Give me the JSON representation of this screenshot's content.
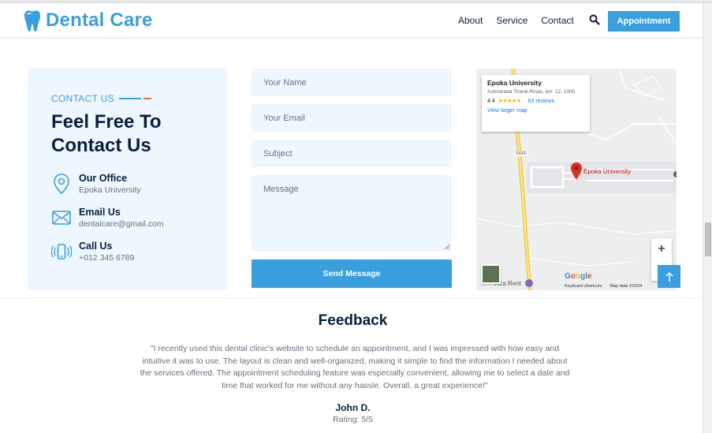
{
  "header": {
    "logo_text": "Dental Care",
    "nav": [
      "About",
      "Service",
      "Contact"
    ],
    "appointment_label": "Appointment"
  },
  "contact": {
    "eyebrow": "CONTACT US",
    "title": "Feel Free To Contact Us",
    "office_label": "Our Office",
    "office_value": "Epoka University",
    "email_label": "Email Us",
    "email_value": "dentalcare@gmail.com",
    "call_label": "Call Us",
    "call_value": "+012 345 6789"
  },
  "form": {
    "name_placeholder": "Your Name",
    "email_placeholder": "Your Email",
    "subject_placeholder": "Subject",
    "message_placeholder": "Message",
    "send_label": "Send Message"
  },
  "map": {
    "place_name": "Epoka University",
    "address": "Autostrada Tiranë-Rinas, km. 12, 1000",
    "rating": "4.4",
    "stars": "★★★★★",
    "reviews": "63 reviews",
    "larger_map": "View larger map",
    "pin_label": "Epoka University",
    "road_label": "SH60",
    "zoom_in": "+",
    "zoom_out": "−",
    "google": "Google",
    "keyboard": "Keyboard shortcuts",
    "map_data": "Map data ©2024",
    "nearby_place": "Aca Rent"
  },
  "feedback": {
    "title": "Feedback",
    "quote": "\"I recently used this dental clinic's website to schedule an appointment, and I was impressed with how easy and intuitive it was to use. The layout is clean and well-organized, making it simple to find the information I needed about the services offered. The appointment scheduling feature was especially convenient, allowing me to select a date and time that worked for me without any hassle. Overall, a great experience!\"",
    "author": "John D.",
    "rating": "Rating: 5/5"
  },
  "colors": {
    "primary": "#3a9fdf",
    "dark": "#091e3e",
    "light_bg": "#eef7ff",
    "accent": "#ef6c2e"
  }
}
